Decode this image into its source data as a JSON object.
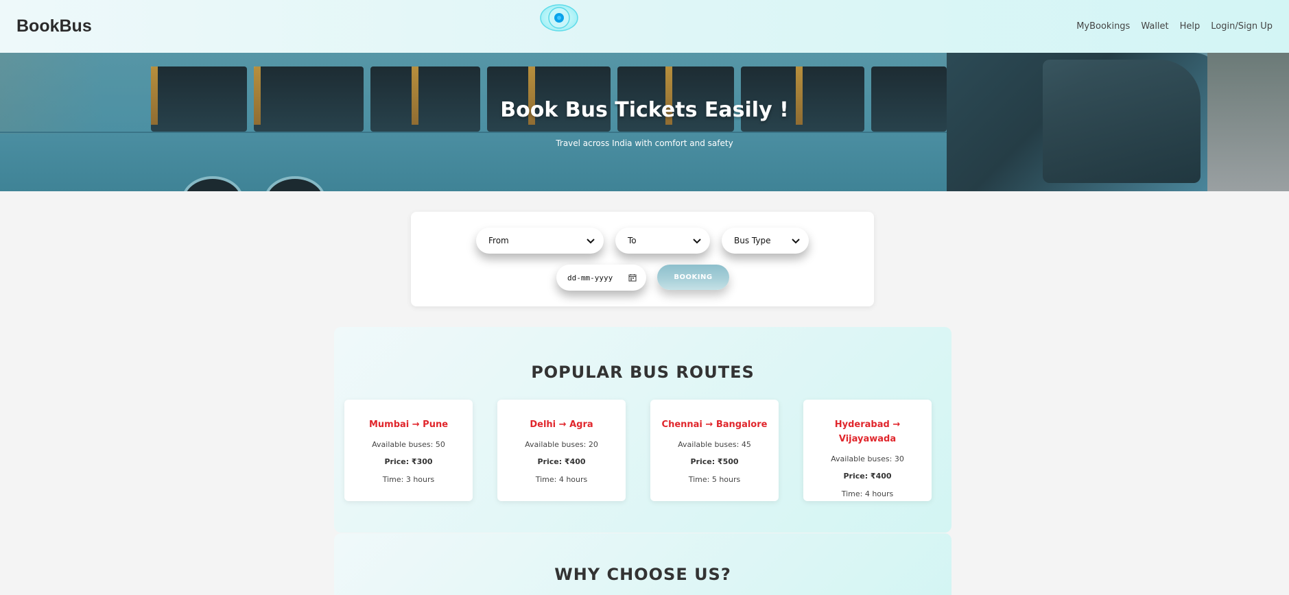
{
  "navbar": {
    "brand": "BookBus",
    "links": [
      "MyBookings",
      "Wallet",
      "Help",
      "Login/Sign Up"
    ]
  },
  "hero": {
    "title": "Book Bus Tickets Easily !",
    "subtitle": "Travel across India with comfort and safety"
  },
  "search": {
    "from_label": "From",
    "to_label": "To",
    "bus_type_label": "Bus Type",
    "date_placeholder": "dd-mm-yyyy",
    "booking_label": "BOOKING"
  },
  "popular": {
    "title": "POPULAR BUS ROUTES",
    "routes": [
      {
        "name": "Mumbai → Pune",
        "available": "Available buses: 50",
        "price": "Price: ₹300",
        "time": "Time: 3 hours"
      },
      {
        "name": "Delhi → Agra",
        "available": "Available buses: 20",
        "price": "Price: ₹400",
        "time": "Time: 4 hours"
      },
      {
        "name": "Chennai → Bangalore",
        "available": "Available buses: 45",
        "price": "Price: ₹500",
        "time": "Time: 5 hours"
      },
      {
        "name": "Hyderabad → Vijayawada",
        "available": "Available buses: 30",
        "price": "Price: ₹400",
        "time": "Time: 4 hours"
      }
    ]
  },
  "why": {
    "title": "WHY CHOOSE US?"
  },
  "colors": {
    "accent_red": "#e0262c",
    "navbar_bg": "#dff6f7",
    "booking_button": "#a7cfd8"
  },
  "icons": {
    "logo": "eye-logo-icon",
    "select_arrow": "chevron-down-icon",
    "date": "calendar-icon"
  }
}
